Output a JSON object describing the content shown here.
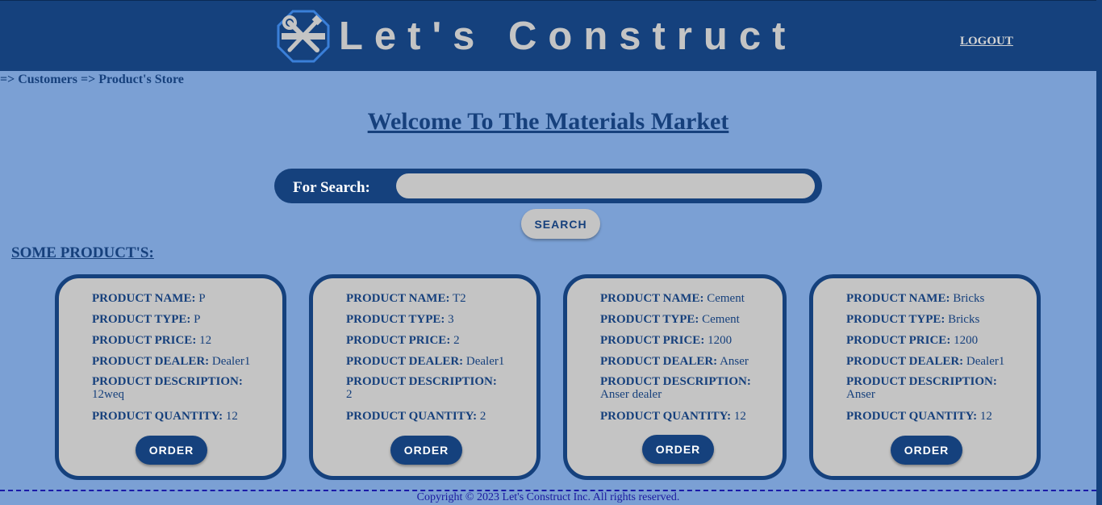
{
  "header": {
    "brand": "Let's Construct",
    "logout_label": "LOGOUT",
    "logo_icon": "tools-wrench-screwdriver-icon"
  },
  "breadcrumb": "=> Customers => Product's Store",
  "welcome_title": "Welcome To The Materials Market",
  "search": {
    "label": "For Search:",
    "value": "",
    "placeholder": "",
    "button_label": "SEARCH"
  },
  "section_title": "SOME PRODUCT'S:",
  "field_labels": {
    "name": "PRODUCT NAME:",
    "type": "PRODUCT TYPE:",
    "price": "PRODUCT PRICE:",
    "dealer": "PRODUCT DEALER:",
    "description": "PRODUCT DESCRIPTION:",
    "quantity": "PRODUCT QUANTITY:"
  },
  "products": [
    {
      "name": "P",
      "type": "P",
      "price": "12",
      "dealer": "Dealer1",
      "description": "12weq",
      "quantity": "12",
      "order_label": "ORDER"
    },
    {
      "name": "T2",
      "type": "3",
      "price": "2",
      "dealer": "Dealer1",
      "description": "2",
      "quantity": "2",
      "order_label": "ORDER"
    },
    {
      "name": "Cement",
      "type": "Cement",
      "price": "1200",
      "dealer": "Anser",
      "description": "Anser dealer",
      "quantity": "12",
      "order_label": "ORDER"
    },
    {
      "name": "Bricks",
      "type": "Bricks",
      "price": "1200",
      "dealer": "Dealer1",
      "description": "Anser",
      "quantity": "12",
      "order_label": "ORDER"
    }
  ],
  "footer": "Copyright © 2023 Let's Construct Inc. All rights reserved.",
  "colors": {
    "primary": "#15417d",
    "background": "#7ba0d4",
    "card": "#c4c4c4"
  }
}
